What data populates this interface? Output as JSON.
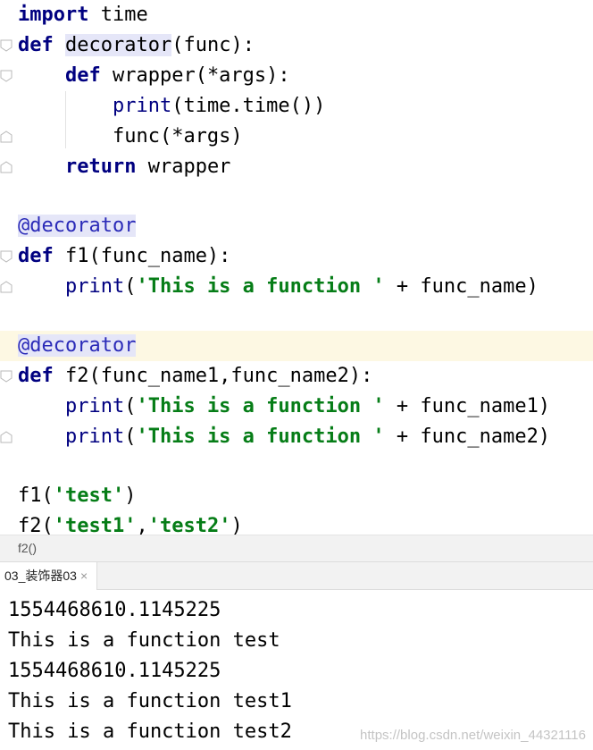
{
  "editor": {
    "lines": {
      "l1": {
        "import": "import",
        "time": " time"
      },
      "l2": {
        "def": "def",
        "name": "decorator",
        "rest": "(func):"
      },
      "l3": {
        "def": "def",
        "rest": " wrapper(*args):"
      },
      "l4": {
        "print": "print",
        "rest": "(time.time())"
      },
      "l5": {
        "text": "func(*args)"
      },
      "l6": {
        "return": "return",
        "rest": " wrapper"
      },
      "l8": {
        "decorator": "@decorator"
      },
      "l9": {
        "def": "def",
        "rest": " f1(func_name):"
      },
      "l10": {
        "print": "print",
        "open": "(",
        "str": "'This is a function '",
        "rest": " + func_name)"
      },
      "l12": {
        "decorator": "@decorator"
      },
      "l13": {
        "def": "def",
        "rest": " f2(func_name1,func_name2):"
      },
      "l14": {
        "print": "print",
        "open": "(",
        "str": "'This is a function '",
        "rest": " + func_name1)"
      },
      "l15": {
        "print": "print",
        "open": "(",
        "str": "'This is a function '",
        "rest": " + func_name2)"
      },
      "l17": {
        "call": "f1(",
        "str": "'test'",
        "close": ")"
      },
      "l18": {
        "call": "f2(",
        "str1": "'test1'",
        "comma": ",",
        "str2": "'test2'",
        "close": ")"
      }
    }
  },
  "breadcrumb": {
    "text": "f2()"
  },
  "run_tab": {
    "label": "03_装饰器03",
    "close_glyph": "×"
  },
  "console": {
    "lines": [
      "1554468610.1145225",
      "This is a function test",
      "1554468610.1145225",
      "This is a function test1",
      "This is a function test2"
    ]
  },
  "watermark": {
    "text": "https://blog.csdn.net/weixin_44321116"
  },
  "colors": {
    "keyword": "#000080",
    "string": "#067d17",
    "decorator": "#2b2bb8",
    "current_line": "#fdf8e3"
  }
}
